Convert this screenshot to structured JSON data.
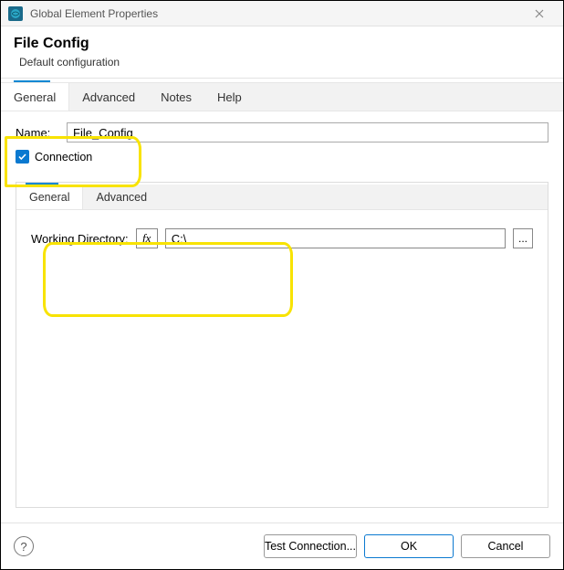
{
  "window": {
    "title": "Global Element Properties"
  },
  "header": {
    "title": "File Config",
    "subtitle": "Default configuration"
  },
  "tabs": {
    "items": [
      "General",
      "Advanced",
      "Notes",
      "Help"
    ],
    "active_index": 0
  },
  "fields": {
    "name_label": "Name:",
    "name_value": "File_Config",
    "connection_label": "Connection",
    "connection_checked": true
  },
  "inner_tabs": {
    "items": [
      "General",
      "Advanced"
    ],
    "active_index": 0
  },
  "working_dir": {
    "label": "Working Directory:",
    "fx_label": "fx",
    "value": "C:\\",
    "browse_label": "..."
  },
  "footer": {
    "test_label": "Test Connection...",
    "ok_label": "OK",
    "cancel_label": "Cancel"
  }
}
